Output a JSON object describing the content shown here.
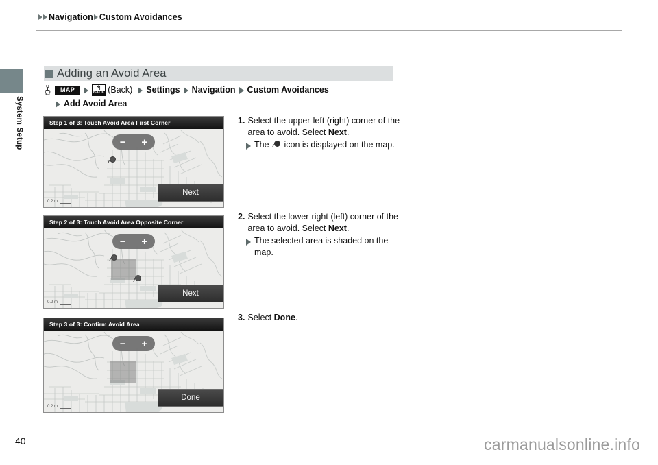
{
  "breadcrumb": {
    "items": [
      "Navigation",
      "Custom Avoidances"
    ]
  },
  "sidebar": {
    "label": "System Setup"
  },
  "section": {
    "title": "Adding an Avoid Area"
  },
  "operation_path": {
    "map_button": "MAP",
    "back_arrow": "↰",
    "back_label": "BACK",
    "back_text": "(Back)",
    "steps": [
      "Settings",
      "Navigation",
      "Custom Avoidances"
    ],
    "final_step": "Add Avoid Area"
  },
  "screens": [
    {
      "title": "Step 1 of 3: Touch Avoid Area First Corner",
      "zoom_out": "−",
      "zoom_in": "+",
      "action_label": "Next",
      "scale": "0.2 mi"
    },
    {
      "title": "Step 2 of 3: Touch Avoid Area Opposite Corner",
      "zoom_out": "−",
      "zoom_in": "+",
      "action_label": "Next",
      "scale": "0.2 mi"
    },
    {
      "title": "Step 3 of 3: Confirm Avoid Area",
      "zoom_out": "−",
      "zoom_in": "+",
      "action_label": "Done",
      "scale": "0.2 mi"
    }
  ],
  "instructions": [
    {
      "number": "1.",
      "text_a": "Select the upper-left (right) corner of the area to avoid. Select ",
      "bold": "Next",
      "text_b": ".",
      "sub_a": "The ",
      "sub_b": " icon is displayed on the map."
    },
    {
      "number": "2.",
      "text_a": "Select the lower-right (left) corner of the area to avoid. Select ",
      "bold": "Next",
      "text_b": ".",
      "sub_a": "The selected area is shaded on the map.",
      "sub_b": ""
    },
    {
      "number": "3.",
      "text_a": "Select ",
      "bold": "Done",
      "text_b": ".",
      "sub_a": "",
      "sub_b": ""
    }
  ],
  "footer": {
    "page_number": "40",
    "watermark": "carmanualsonline.info"
  },
  "colors": {
    "accent": "#76878a",
    "band": "#dcdfe0",
    "triangle": "#5d6a6a"
  }
}
